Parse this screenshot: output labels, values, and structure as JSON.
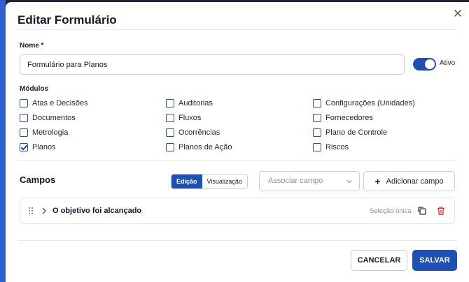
{
  "dialog": {
    "title": "Editar Formulário",
    "close_icon": "close-icon"
  },
  "name_field": {
    "label": "Nome *",
    "value": "Formulário para Planos"
  },
  "status_toggle": {
    "label": "Ativo",
    "on": true,
    "color": "#1e4fb5"
  },
  "modules": {
    "label": "Módulos",
    "items": [
      {
        "label": "Atas e Decisões",
        "checked": false
      },
      {
        "label": "Auditorias",
        "checked": false
      },
      {
        "label": "Configurações (Unidades)",
        "checked": false
      },
      {
        "label": "Documentos",
        "checked": false
      },
      {
        "label": "Fluxos",
        "checked": false
      },
      {
        "label": "Fornecedores",
        "checked": false
      },
      {
        "label": "Metrologia",
        "checked": false
      },
      {
        "label": "Ocorrências",
        "checked": false
      },
      {
        "label": "Plano de Controle",
        "checked": false
      },
      {
        "label": "Planos",
        "checked": true
      },
      {
        "label": "Planos de Ação",
        "checked": false
      },
      {
        "label": "Riscos",
        "checked": false
      }
    ]
  },
  "fields_section": {
    "title": "Campos",
    "view_toggle": {
      "edit_label": "Edição",
      "preview_label": "Visualização",
      "selected": "Edição"
    },
    "associate_select": {
      "placeholder": "Associar campo"
    },
    "add_button": {
      "label": "Adicionar campo",
      "icon": "plus-icon"
    },
    "items": [
      {
        "name": "O objetivo foi alcançado",
        "type": "Seleção única"
      }
    ]
  },
  "footer": {
    "cancel_label": "CANCELAR",
    "save_label": "SALVAR"
  },
  "colors": {
    "primary": "#1e4fb5",
    "danger": "#e0383e",
    "backdrop": "#1d2635"
  }
}
